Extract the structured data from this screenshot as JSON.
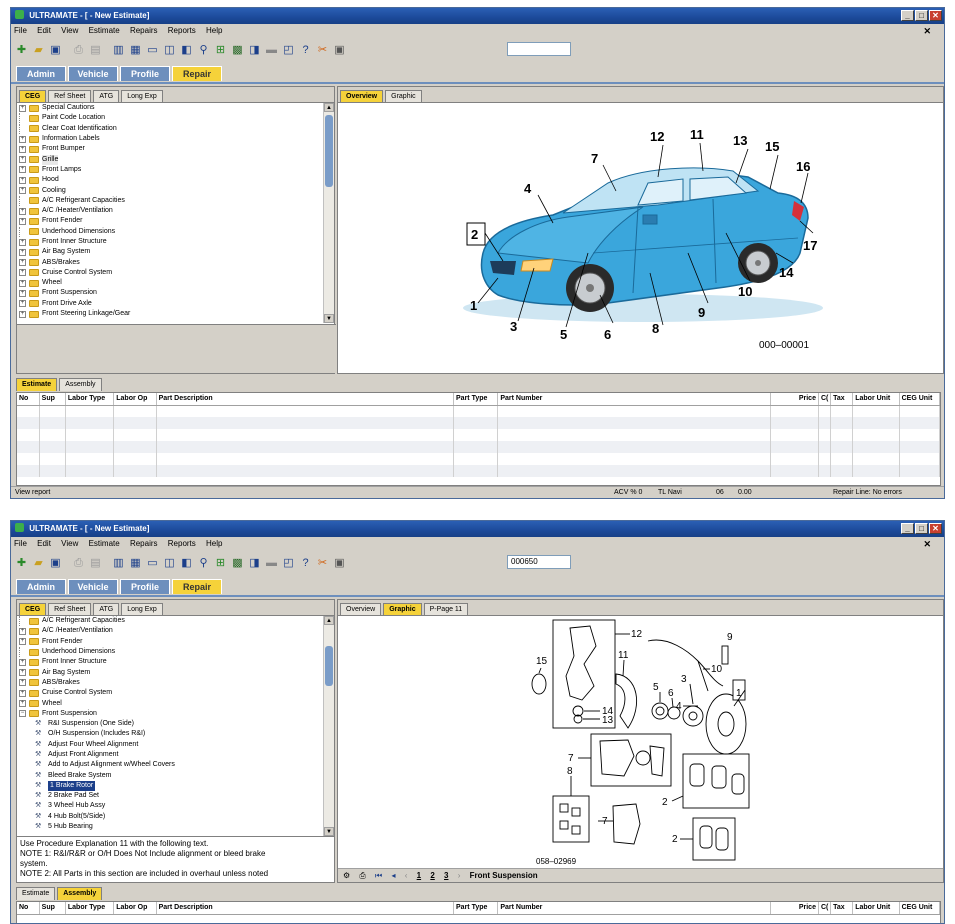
{
  "windows": [
    {
      "title": "ULTRAMATE - [ - New Estimate]",
      "menu": [
        "File",
        "Edit",
        "View",
        "Estimate",
        "Repairs",
        "Reports",
        "Help"
      ],
      "toolbar_field_value": "",
      "main_tabs": [
        "Admin",
        "Vehicle",
        "Profile",
        "Repair"
      ],
      "active_main_tab": "Repair",
      "left_tabs": [
        "CEG",
        "Ref Sheet",
        "ATG",
        "Long Exp"
      ],
      "tree": [
        {
          "label": "Special Cautions",
          "expandable": true
        },
        {
          "label": "Paint Code Location",
          "expandable": false
        },
        {
          "label": "Clear Coat Identification",
          "expandable": false
        },
        {
          "label": "Information Labels",
          "expandable": true
        },
        {
          "label": "Front Bumper",
          "expandable": true
        },
        {
          "label": "Grille",
          "expandable": true,
          "highlighted": true
        },
        {
          "label": "Front Lamps",
          "expandable": true
        },
        {
          "label": "Hood",
          "expandable": true
        },
        {
          "label": "Cooling",
          "expandable": true
        },
        {
          "label": "A/C Refrigerant Capacities",
          "expandable": false
        },
        {
          "label": "A/C /Heater/Ventilation",
          "expandable": true
        },
        {
          "label": "Front Fender",
          "expandable": true
        },
        {
          "label": "Underhood Dimensions",
          "expandable": false
        },
        {
          "label": "Front Inner Structure",
          "expandable": true
        },
        {
          "label": "Air Bag System",
          "expandable": true
        },
        {
          "label": "ABS/Brakes",
          "expandable": true
        },
        {
          "label": "Cruise Control System",
          "expandable": true
        },
        {
          "label": "Wheel",
          "expandable": true
        },
        {
          "label": "Front Suspension",
          "expandable": true
        },
        {
          "label": "Front Drive Axle",
          "expandable": true
        },
        {
          "label": "Front Steering Linkage/Gear",
          "expandable": true
        }
      ],
      "right_tabs": [
        "Overview",
        "Graphic"
      ],
      "active_right_tab": "Overview",
      "diagram": {
        "callouts": [
          "1",
          "2",
          "3",
          "4",
          "5",
          "6",
          "7",
          "8",
          "9",
          "10",
          "11",
          "12",
          "13",
          "15",
          "16",
          "17",
          "14"
        ],
        "figure_id": "000–00001"
      },
      "bottom_tabs": [
        "Estimate",
        "Assembly"
      ],
      "active_bottom_tab": "Estimate",
      "grid_columns": [
        "No",
        "Sup",
        "Labor Type",
        "Labor Op",
        "Part Description",
        "Part Type",
        "Part Number",
        "Price",
        "C(",
        "Tax",
        "Labor Unit",
        "CEG Unit"
      ],
      "status": {
        "left": "View report",
        "acv": "ACV % 0",
        "navi": "TL Navi",
        "code": "06",
        "amount": "0.00",
        "repair_line": "Repair Line: No errors"
      }
    },
    {
      "title": "ULTRAMATE - [ - New Estimate]",
      "menu": [
        "File",
        "Edit",
        "View",
        "Estimate",
        "Repairs",
        "Reports",
        "Help"
      ],
      "toolbar_field_value": "000650",
      "main_tabs": [
        "Admin",
        "Vehicle",
        "Profile",
        "Repair"
      ],
      "active_main_tab": "Repair",
      "left_tabs": [
        "CEG",
        "Ref Sheet",
        "ATG",
        "Long Exp"
      ],
      "tree": [
        {
          "label": "A/C Refrigerant Capacities",
          "kind": "folder",
          "expandable": false
        },
        {
          "label": "A/C /Heater/Ventilation",
          "kind": "folder",
          "expandable": true
        },
        {
          "label": "Front Fender",
          "kind": "folder",
          "expandable": true
        },
        {
          "label": "Underhood Dimensions",
          "kind": "folder",
          "expandable": false
        },
        {
          "label": "Front Inner Structure",
          "kind": "folder",
          "expandable": true
        },
        {
          "label": "Air Bag System",
          "kind": "folder",
          "expandable": true
        },
        {
          "label": "ABS/Brakes",
          "kind": "folder",
          "expandable": true
        },
        {
          "label": "Cruise Control System",
          "kind": "folder",
          "expandable": true
        },
        {
          "label": "Wheel",
          "kind": "folder",
          "expandable": true
        },
        {
          "label": "Front Suspension",
          "kind": "folder",
          "expandable": true,
          "open": true
        },
        {
          "label": "R&I Suspension (One Side)",
          "kind": "op"
        },
        {
          "label": "O/H Suspension (Includes R&I)",
          "kind": "op"
        },
        {
          "label": "Adjust Four Wheel Alignment",
          "kind": "op"
        },
        {
          "label": "Adjust Front Alignment",
          "kind": "op"
        },
        {
          "label": "Add to Adjust Alignment w/Wheel Covers",
          "kind": "op"
        },
        {
          "label": "Bleed Brake System",
          "kind": "op"
        },
        {
          "label": "1  Brake Rotor",
          "kind": "op",
          "selected": true
        },
        {
          "label": "2  Brake Pad Set",
          "kind": "op"
        },
        {
          "label": "3  Wheel Hub Assy",
          "kind": "op"
        },
        {
          "label": "4  Hub Bolt(5/Side)",
          "kind": "op"
        },
        {
          "label": "5  Hub Bearing",
          "kind": "op"
        }
      ],
      "note_lines": [
        "Use Procedure Explanation 11 with the following text.",
        "NOTE 1: R&I/R&R or O/H Does Not Include alignment or bleed brake",
        "system.",
        "NOTE 2: All Parts in this section are included in overhaul unless noted"
      ],
      "right_tabs": [
        "Overview",
        "Graphic",
        "P-Page 11"
      ],
      "active_right_tab": "Graphic",
      "diagram": {
        "callouts": [
          "12",
          "9",
          "15",
          "11",
          "10",
          "5",
          "6",
          "3",
          "4",
          "1",
          "14",
          "13",
          "7",
          "8",
          "2",
          "7",
          "2"
        ],
        "figure_id": "058–02969"
      },
      "pager": {
        "pages": [
          "1",
          "2",
          "3"
        ],
        "section": "Front Suspension"
      },
      "bottom_tabs": [
        "Estimate",
        "Assembly"
      ],
      "active_bottom_tab": "Assembly",
      "grid_columns": [
        "No",
        "Sup",
        "Labor Type",
        "Labor Op",
        "Part Description",
        "Part Type",
        "Part Number",
        "Price",
        "C(",
        "Tax",
        "Labor Unit",
        "CEG Unit"
      ]
    }
  ],
  "colors": {
    "titlebar": "#1c4a9a",
    "tab_blue": "#6d8fbd",
    "tab_active": "#f5d23a",
    "car_body": "#3aa6dc",
    "selection": "#1c3f8a"
  }
}
